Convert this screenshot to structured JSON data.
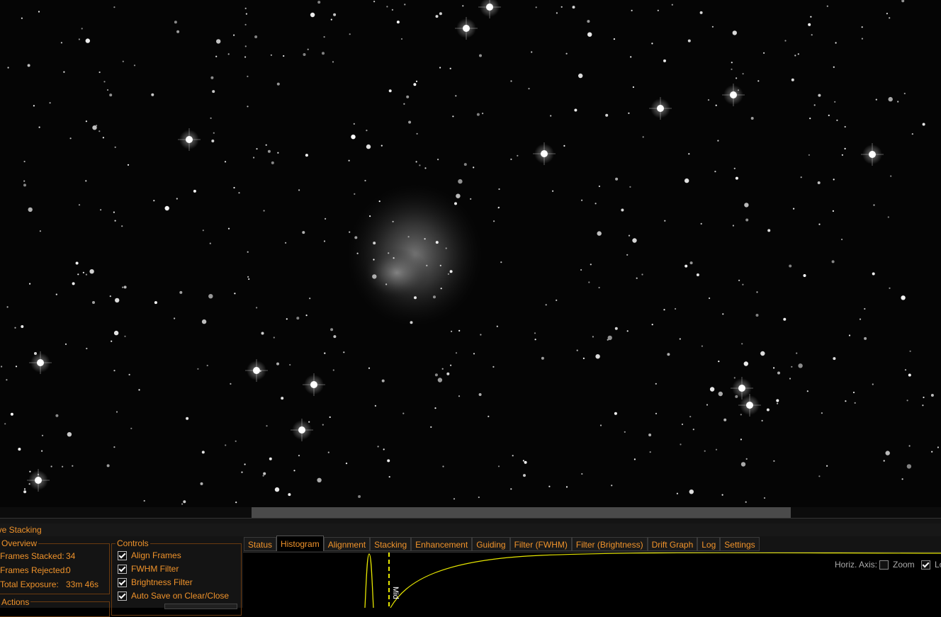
{
  "panel": {
    "title": "ive Stacking"
  },
  "overview": {
    "label": "Overview",
    "frames_stacked_label": "Frames Stacked:",
    "frames_stacked_value": "34",
    "frames_rejected_label": "Frames Rejected:",
    "frames_rejected_value": "0",
    "total_exposure_label": "Total Exposure:",
    "total_exposure_value": "33m 46s"
  },
  "actions": {
    "label": "Actions"
  },
  "controls": {
    "label": "Controls",
    "items": [
      {
        "label": "Align Frames",
        "checked": true
      },
      {
        "label": "FWHM Filter",
        "checked": true
      },
      {
        "label": "Brightness Filter",
        "checked": true
      },
      {
        "label": "Auto Save on Clear/Close",
        "checked": true
      }
    ]
  },
  "tabs": [
    "Status",
    "Histogram",
    "Alignment",
    "Stacking",
    "Enhancement",
    "Guiding",
    "Filter (FWHM)",
    "Filter (Brightness)",
    "Drift Graph",
    "Log",
    "Settings"
  ],
  "active_tab": "Histogram",
  "histogram": {
    "horiz_axis_label": "Horiz. Axis:",
    "zoom_label": "Zoom",
    "zoom_checked": false,
    "log_label": "Lo",
    "log_checked": true,
    "mid_label": "Mid"
  },
  "colors": {
    "accent": "#f0932b",
    "curve": "#e6e600"
  }
}
